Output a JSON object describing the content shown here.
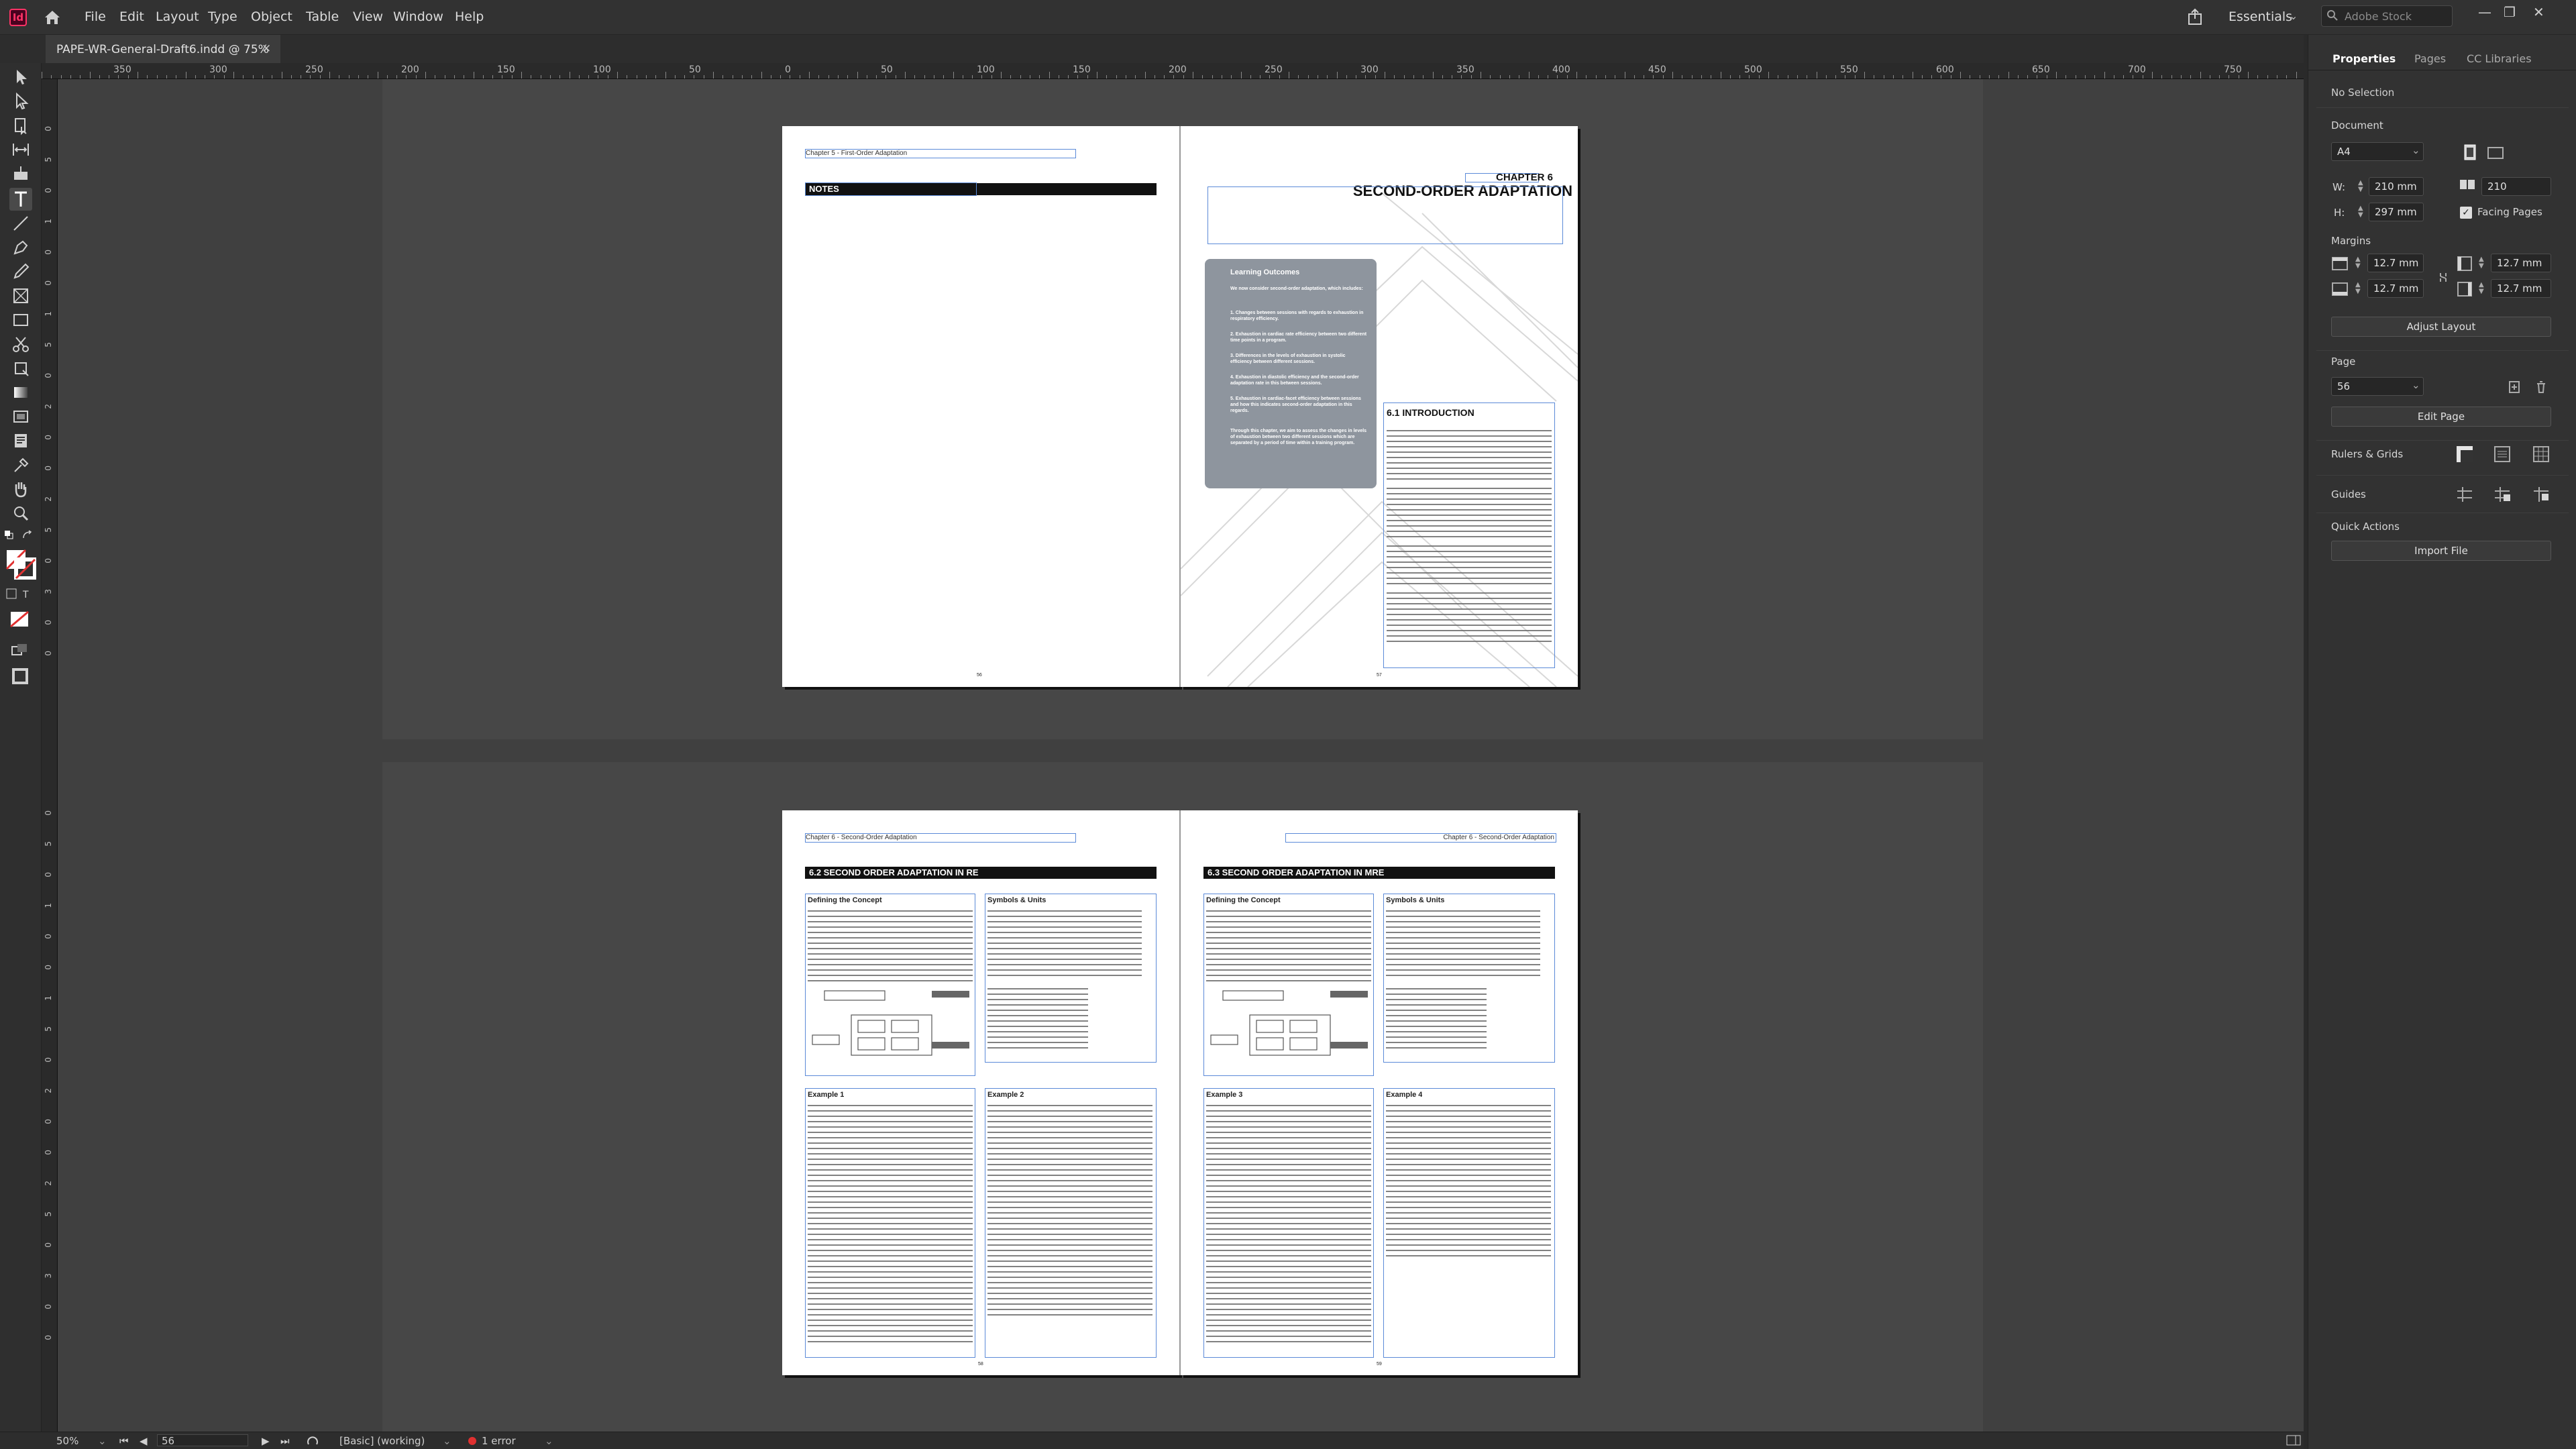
{
  "app": {
    "logo": "Id",
    "home_icon": "home-icon"
  },
  "menu": [
    "File",
    "Edit",
    "Layout",
    "Type",
    "Object",
    "Table",
    "View",
    "Window",
    "Help"
  ],
  "topbar": {
    "workspace": "Essentials",
    "search_placeholder": "Adobe Stock",
    "window_controls": [
      "—",
      "❐",
      "✕"
    ]
  },
  "document_tab": {
    "title": "PAPE-WR-General-Draft6.indd @ 75%",
    "close": "×"
  },
  "ruler": {
    "h_labels": [
      "350",
      "300",
      "250",
      "200",
      "150",
      "100",
      "50",
      "0",
      "50",
      "100",
      "150",
      "200",
      "250",
      "300",
      "350",
      "400",
      "450",
      "500",
      "550",
      "600",
      "650",
      "700",
      "750"
    ],
    "v_labels_top": [
      "0",
      "5",
      "0",
      "1",
      "0",
      "0",
      "1",
      "5",
      "0",
      "2",
      "0",
      "0",
      "2",
      "5",
      "0",
      "3",
      "0",
      "0"
    ],
    "v_labels_bottom": [
      "0",
      "5",
      "0",
      "1",
      "0",
      "0",
      "1",
      "5",
      "0",
      "2",
      "0",
      "0",
      "2",
      "5",
      "0",
      "3",
      "0",
      "0"
    ]
  },
  "spread1": {
    "left_header": "Chapter 5 - First-Order Adaptation",
    "notes_title": "NOTES",
    "chapter_label": "CHAPTER 6",
    "chapter_title": "SECOND-ORDER ADAPTATION",
    "lo_title": "Learning Outcomes",
    "lo_intro": "We now consider second-order adaptation, which includes:",
    "lo_items": [
      "1. Changes between sessions with regards to exhaustion in respiratory efficiency.",
      "2. Exhaustion in cardiac rate efficiency between two different time points in a program.",
      "3. Differences in the levels of exhaustion in systolic efficiency between different sessions.",
      "4. Exhaustion in diastolic efficiency and the second-order adaptation rate in this between sessions.",
      "5. Exhaustion in cardiac-facet efficiency between sessions and how this indicates second-order adaptation in this regards."
    ],
    "lo_outro": "Through this chapter, we aim to assess the changes in levels of exhaustion between two different sessions which are separated by a period of time within a training program.",
    "intro_title": "6.1 INTRODUCTION",
    "left_page_num": "56",
    "right_page_num": "57"
  },
  "spread2": {
    "left_header": "Chapter 6 - Second-Order Adaptation",
    "right_header": "Chapter 6 - Second-Order Adaptation",
    "left_title": "6.2 SECOND ORDER ADAPTATION IN RE",
    "right_title": "6.3 SECOND ORDER ADAPTATION IN MRE",
    "boxes": [
      "Defining the Concept",
      "Symbols & Units",
      "Example 1",
      "Example 2",
      "Example 3",
      "Example 4"
    ],
    "left_page_num": "58",
    "right_page_num": "59"
  },
  "statusbar": {
    "zoom": "50%",
    "page": "56",
    "style": "[Basic] (working)",
    "errors": "1 error"
  },
  "panel": {
    "tabs": [
      "Properties",
      "Pages",
      "CC Libraries"
    ],
    "selection": "No Selection",
    "document_label": "Document",
    "preset": "A4",
    "w_label": "W:",
    "w_value": "210 mm",
    "h_label": "H:",
    "h_value": "297 mm",
    "pages_value": "210",
    "facing_pages": "Facing Pages",
    "margins_label": "Margins",
    "margin_top": "12.7 mm",
    "margin_bottom": "12.7 mm",
    "margin_inside": "12.7 mm",
    "margin_outside": "12.7 mm",
    "adjust_layout": "Adjust Layout",
    "page_label": "Page",
    "page_value": "56",
    "edit_page": "Edit Page",
    "rulers_grids": "Rulers & Grids",
    "guides": "Guides",
    "quick_actions": "Quick Actions",
    "import_file": "Import File"
  },
  "colors": {
    "accent": "#ff3366",
    "frame": "#5b8ad8",
    "lo_box": "#8e959e",
    "error": "#e03030"
  }
}
